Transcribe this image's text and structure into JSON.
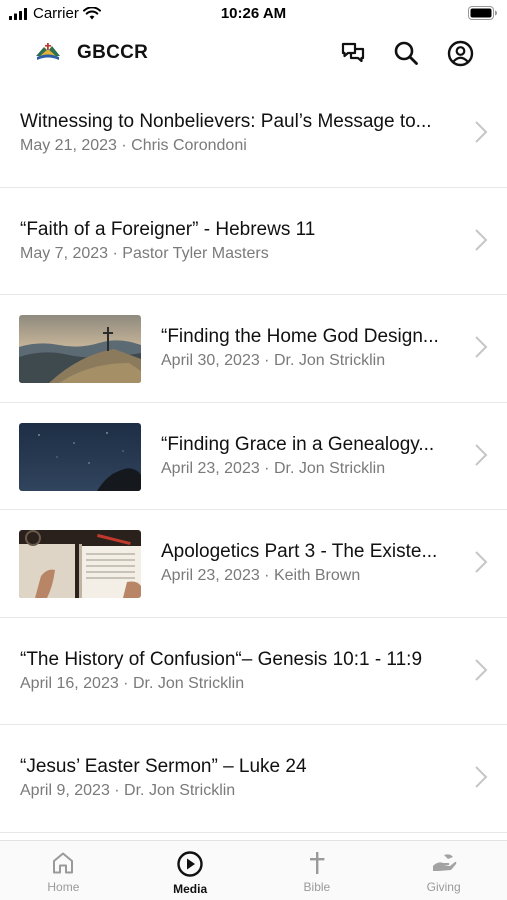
{
  "status_bar": {
    "carrier": "Carrier",
    "time": "10:26 AM"
  },
  "header": {
    "title": "GBCCR"
  },
  "media_items": [
    {
      "title": "Witnessing to Nonbelievers: Paul’s Message to...",
      "meta": "May 21, 2023 · Chris Corondoni"
    },
    {
      "title": "“Faith of a Foreigner” - Hebrews 11",
      "meta": "May 7, 2023 · Pastor Tyler Masters"
    },
    {
      "title": "“Finding the Home God Design...",
      "meta": "April 30, 2023 · Dr. Jon Stricklin"
    },
    {
      "title": "“Finding Grace in a Genealogy...",
      "meta": "April 23, 2023 · Dr. Jon Stricklin"
    },
    {
      "title": "Apologetics Part 3 - The Existe...",
      "meta": "April 23, 2023 · Keith Brown"
    },
    {
      "title": "“The History of Confusion“– Genesis 10:1 - 11:9",
      "meta": "April 16, 2023 · Dr. Jon Stricklin"
    },
    {
      "title": "“Jesus’ Easter Sermon” – Luke 24",
      "meta": "April 9, 2023 · Dr. Jon Stricklin"
    }
  ],
  "tabs": [
    {
      "label": "Home",
      "icon": "home-icon"
    },
    {
      "label": "Media",
      "icon": "play-circle-icon",
      "active": true
    },
    {
      "label": "Bible",
      "icon": "cross-icon"
    },
    {
      "label": "Giving",
      "icon": "giving-hand-icon"
    }
  ],
  "colors": {
    "active_tab": "#111111",
    "inactive_tab": "#9a9a9a",
    "meta_text": "#7a7a7a",
    "divider": "#e8e8e8"
  }
}
